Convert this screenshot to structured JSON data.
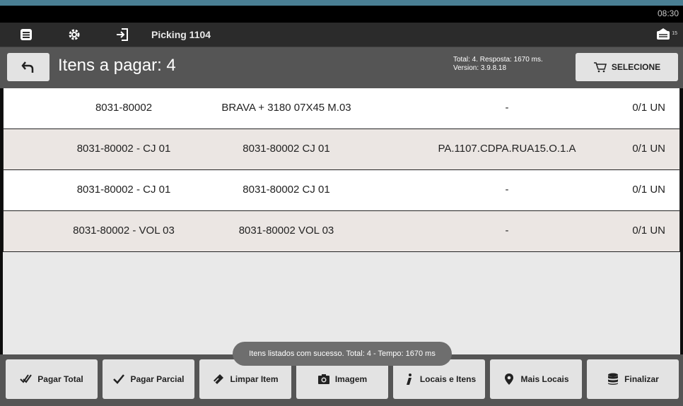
{
  "status_bar": {
    "time": "08:30"
  },
  "action_bar": {
    "title": "Picking 1104",
    "icons": [
      "menu-icon",
      "settings-icon",
      "login-icon"
    ],
    "message_count": "15"
  },
  "header": {
    "title": "Itens a pagar: 4",
    "info_line1": "Total: 4. Resposta: 1670 ms.",
    "info_line2": "Version: 3.9.8.18",
    "select_label": "SELECIONE"
  },
  "items": [
    {
      "code": "8031-80002",
      "description": "BRAVA + 3180 07X45 M.03",
      "location": "-",
      "qty": "0/1 UN"
    },
    {
      "code": "8031-80002 - CJ 01",
      "description": "8031-80002 CJ 01",
      "location": "PA.1107.CDPA.RUA15.O.1.A",
      "qty": "0/1 UN"
    },
    {
      "code": "8031-80002 - CJ 01",
      "description": "8031-80002 CJ 01",
      "location": "-",
      "qty": "0/1 UN"
    },
    {
      "code": "8031-80002 - VOL 03",
      "description": "8031-80002 VOL 03",
      "location": "-",
      "qty": "0/1 UN"
    }
  ],
  "toast": "Itens listados com sucesso. Total: 4 - Tempo: 1670 ms",
  "toolbar": {
    "pagar_total": "Pagar Total",
    "pagar_parcial": "Pagar Parcial",
    "limpar_item": "Limpar Item",
    "imagem": "Imagem",
    "locais_itens": "Locais e Itens",
    "mais_locais": "Mais Locais",
    "finalizar": "Finalizar"
  }
}
